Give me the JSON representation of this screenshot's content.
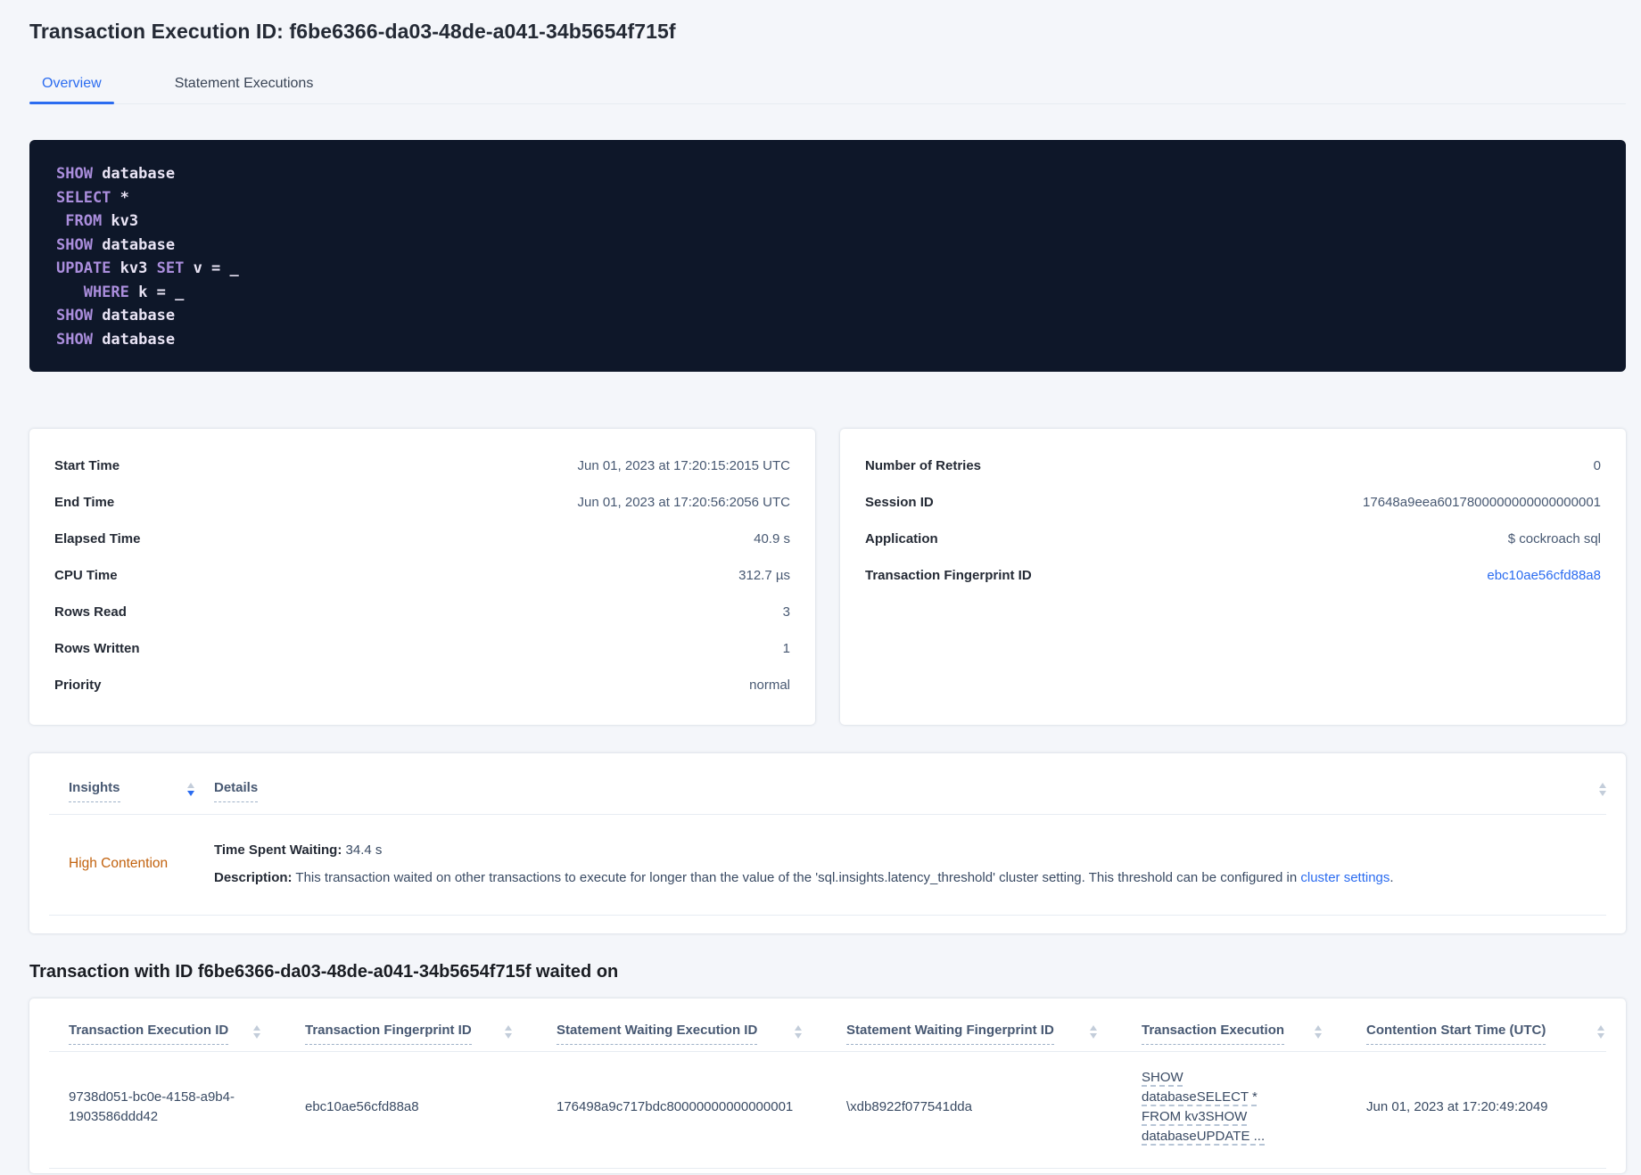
{
  "header": {
    "title": "Transaction Execution ID: f6be6366-da03-48de-a041-34b5654f715f"
  },
  "tabs": {
    "overview": "Overview",
    "statement_executions": "Statement Executions"
  },
  "colors": {
    "accent_blue": "#2b6cf0",
    "insight_orange": "#c2620e",
    "code_background": "#0e1729",
    "code_keyword": "#ab8edd"
  },
  "sql": {
    "lines": [
      {
        "segs": [
          {
            "t": "SHOW"
          },
          {
            "t": " database"
          }
        ]
      },
      {
        "segs": [
          {
            "t": "SELECT"
          },
          {
            "t": " *"
          }
        ]
      },
      {
        "segs": [
          {
            "t": " FROM"
          },
          {
            "t": " kv3"
          }
        ]
      },
      {
        "segs": [
          {
            "t": "SHOW"
          },
          {
            "t": " database"
          }
        ]
      },
      {
        "segs": [
          {
            "t": "UPDATE"
          },
          {
            "t": " kv3 "
          },
          {
            "t": "SET"
          },
          {
            "t": " v = _"
          }
        ]
      },
      {
        "segs": [
          {
            "t": "   WHERE"
          },
          {
            "t": " k = _"
          }
        ]
      },
      {
        "segs": [
          {
            "t": "SHOW"
          },
          {
            "t": " database"
          }
        ]
      },
      {
        "segs": [
          {
            "t": "SHOW"
          },
          {
            "t": " database"
          }
        ]
      }
    ]
  },
  "exec_details": {
    "rows": [
      {
        "label": "Start Time",
        "value": "Jun 01, 2023 at 17:20:15:2015 UTC"
      },
      {
        "label": "End Time",
        "value": "Jun 01, 2023 at 17:20:56:2056 UTC"
      },
      {
        "label": "Elapsed Time",
        "value": "40.9 s"
      },
      {
        "label": "CPU Time",
        "value": "312.7 µs"
      },
      {
        "label": "Rows Read",
        "value": "3"
      },
      {
        "label": "Rows Written",
        "value": "1"
      },
      {
        "label": "Priority",
        "value": "normal"
      }
    ]
  },
  "exec_meta": {
    "rows": [
      {
        "label": "Number of Retries",
        "value": "0"
      },
      {
        "label": "Session ID",
        "value": "17648a9eea6017800000000000000001"
      },
      {
        "label": "Application",
        "value": "$ cockroach sql"
      },
      {
        "label": "Transaction Fingerprint ID",
        "value": "ebc10ae56cfd88a8"
      }
    ]
  },
  "insights": {
    "col_insights": "Insights",
    "col_details": "Details",
    "row": {
      "insight": "High Contention",
      "waiting_label": "Time Spent Waiting:",
      "waiting_value": " 34.4 s",
      "description_label": "Description:",
      "description_text": " This transaction waited on other transactions to execute for longer than the value of the 'sql.insights.latency_threshold' cluster setting. This threshold can be configured in ",
      "description_link": "cluster settings",
      "description_suffix": "."
    }
  },
  "waited_on": {
    "title": "Transaction with ID f6be6366-da03-48de-a041-34b5654f715f waited on",
    "columns": [
      "Transaction Execution ID",
      "Transaction Fingerprint ID",
      "Statement Waiting Execution ID",
      "Statement Waiting Fingerprint ID",
      "Transaction Execution",
      "Contention Start Time (UTC)"
    ],
    "row": {
      "transaction_execution_id": "9738d051-bc0e-4158-a9b4-1903586ddd42",
      "transaction_fingerprint_id": "ebc10ae56cfd88a8",
      "statement_waiting_execution_id": "176498a9c717bdc80000000000000001",
      "statement_waiting_fingerprint_id": "\\xdb8922f077541dda",
      "transaction_execution": "SHOW databaseSELECT * FROM kv3SHOW databaseUPDATE ...",
      "contention_start_time": "Jun 01, 2023 at 17:20:49:2049"
    }
  }
}
